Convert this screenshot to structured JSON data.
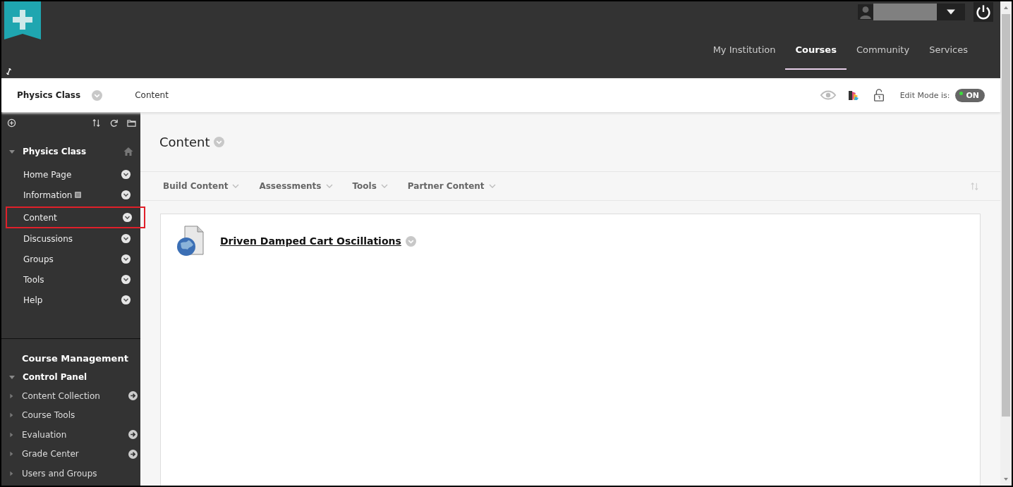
{
  "nav_tabs": [
    {
      "label": "My Institution",
      "selected": false
    },
    {
      "label": "Courses",
      "selected": true
    },
    {
      "label": "Community",
      "selected": false
    },
    {
      "label": "Services",
      "selected": false
    }
  ],
  "breadcrumb": {
    "course": "Physics Class",
    "page": "Content"
  },
  "edit_mode": {
    "label": "Edit Mode is:",
    "value": "ON",
    "on": true
  },
  "course_menu": {
    "title": "Physics Class",
    "expanded": true,
    "items": [
      {
        "label": "Home Page",
        "badge": false,
        "highlighted": false
      },
      {
        "label": "Information",
        "badge": true,
        "highlighted": false
      },
      {
        "label": "Content",
        "badge": false,
        "highlighted": true
      },
      {
        "label": "Discussions",
        "badge": false,
        "highlighted": false
      },
      {
        "label": "Groups",
        "badge": false,
        "highlighted": false
      },
      {
        "label": "Tools",
        "badge": false,
        "highlighted": false
      },
      {
        "label": "Help",
        "badge": false,
        "highlighted": false
      }
    ]
  },
  "management": {
    "title": "Course Management",
    "panel_title": "Control Panel",
    "panel_expanded": true,
    "items": [
      {
        "label": "Content Collection",
        "arrow": true
      },
      {
        "label": "Course Tools",
        "arrow": false
      },
      {
        "label": "Evaluation",
        "arrow": true
      },
      {
        "label": "Grade Center",
        "arrow": true
      },
      {
        "label": "Users and Groups",
        "arrow": false
      }
    ]
  },
  "page_title": "Content",
  "action_bar": [
    "Build Content",
    "Assessments",
    "Tools",
    "Partner Content"
  ],
  "content_items": [
    {
      "title": "Driven Damped Cart Oscillations"
    }
  ]
}
